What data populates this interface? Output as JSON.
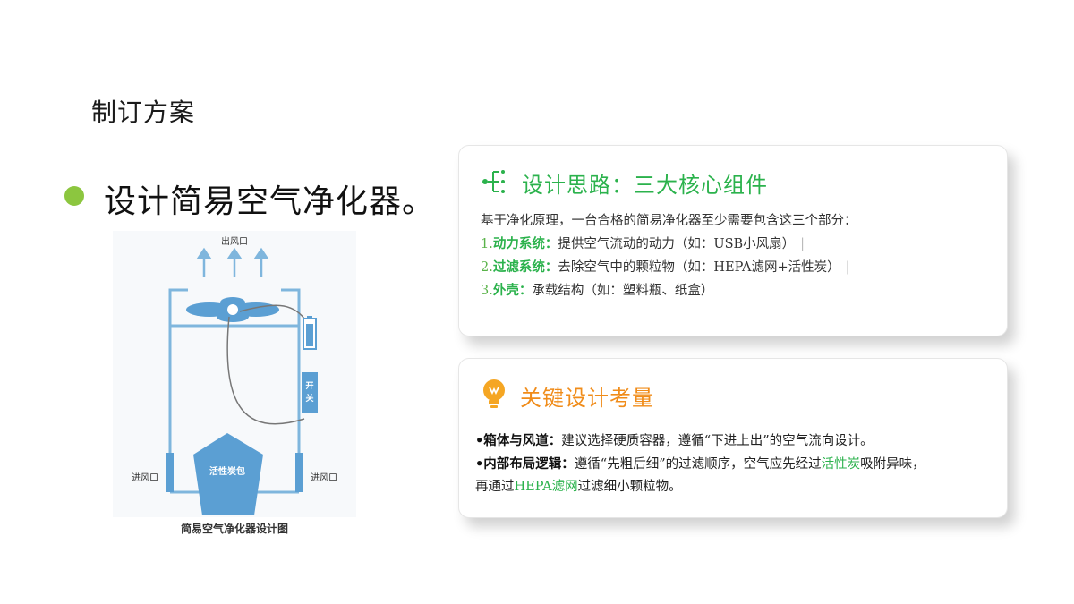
{
  "slide": {
    "section_title": "制订方案",
    "headline": "设计简易空气净化器。"
  },
  "diagram": {
    "top_label": "出风口",
    "switch_label": "开\n关",
    "carbon_label": "活性炭包",
    "inlet_left": "进风口",
    "inlet_right": "进风口",
    "caption": "简易空气净化器设计图",
    "colors": {
      "blue": "#5b9fd3",
      "frame": "#7fb6dd"
    }
  },
  "card1": {
    "icon": "tree-structure-icon",
    "title": "设计思路：三大核心组件",
    "intro": "基于净化原理，一台合格的简易净化器至少需要包含这三个部分：",
    "items": [
      {
        "num": "1.",
        "name": "动力系统：",
        "text": "提供空气流动的动力（如：USB小风扇）",
        "sep": "|"
      },
      {
        "num": "2.",
        "name": "过滤系统：",
        "text": "去除空气中的颗粒物（如：HEPA滤网+活性炭）",
        "sep": "|"
      },
      {
        "num": "3.",
        "name": "外壳：",
        "text": "承载结构（如：塑料瓶、纸盒）",
        "sep": ""
      }
    ],
    "accent": "#2bb24c"
  },
  "card2": {
    "icon": "lightbulb-icon",
    "title": "关键设计考量",
    "p1_label": "•箱体与风道：",
    "p1_text": "建议选择硬质容器，遵循“下进上出”的空气流向设计。",
    "p2_label": "•内部布局逻辑：",
    "p2_text_a": "遵循“先粗后细”的过滤顺序，空气应先经过",
    "p2_hl1": "活性炭",
    "p2_text_b": "吸附异味，",
    "p2_text_c": "再通过",
    "p2_hl2": "HEPA滤网",
    "p2_text_d": "过滤细小颗粒物。",
    "accent": "#f08c1a"
  }
}
